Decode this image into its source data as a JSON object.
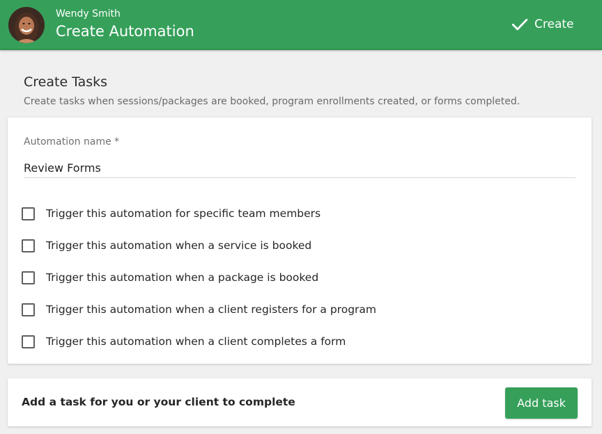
{
  "header": {
    "user_name": "Wendy Smith",
    "title": "Create Automation",
    "create_label": "Create",
    "brand_color": "#36a05a"
  },
  "section": {
    "title": "Create Tasks",
    "description": "Create tasks when sessions/packages are booked, program enrollments created, or forms completed."
  },
  "form": {
    "name_label": "Automation name *",
    "name_value": "Review Forms",
    "options": [
      {
        "label": "Trigger this automation for specific team members",
        "checked": false
      },
      {
        "label": "Trigger this automation when a service is booked",
        "checked": false
      },
      {
        "label": "Trigger this automation when a package is booked",
        "checked": false
      },
      {
        "label": "Trigger this automation when a client registers for a program",
        "checked": false
      },
      {
        "label": "Trigger this automation when a client completes a form",
        "checked": false
      }
    ]
  },
  "task_card": {
    "text": "Add a task for you or your client to complete",
    "button_label": "Add task"
  },
  "icons": {
    "avatar": "user-avatar",
    "create": "checkmark-icon"
  }
}
